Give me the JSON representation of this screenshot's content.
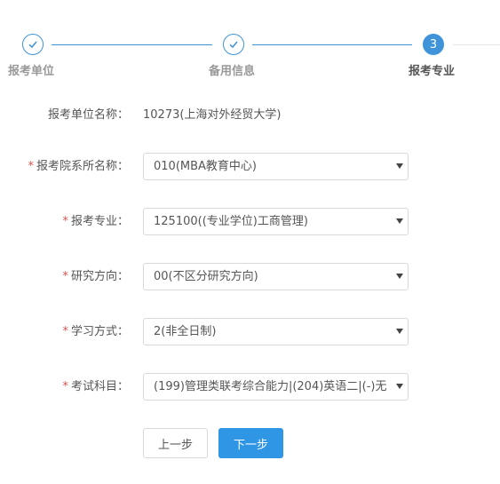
{
  "steps": [
    {
      "label": "报考单位",
      "state": "done"
    },
    {
      "label": "备用信息",
      "state": "done"
    },
    {
      "label": "报考专业",
      "number": "3",
      "state": "active"
    }
  ],
  "form": {
    "unit_label": "报考单位名称：",
    "unit_value": "10273(上海对外经贸大学)",
    "required_mark": "*",
    "department_label": "报考院系所名称：",
    "department_value": "010(MBA教育中心)",
    "major_label": "报考专业：",
    "major_value": "125100((专业学位)工商管理)",
    "direction_label": "研究方向：",
    "direction_value": "00(不区分研究方向)",
    "study_mode_label": "学习方式：",
    "study_mode_value": "2(非全日制)",
    "subjects_label": "考试科目：",
    "subjects_value": "(199)管理类联考综合能力|(204)英语二|(-)无"
  },
  "buttons": {
    "prev": "上一步",
    "next": "下一步"
  },
  "colors": {
    "accent": "#3f93d8",
    "required": "#d9534f",
    "next_button": "#2f96e6"
  },
  "icons": {
    "done": "check-icon",
    "dropdown": "caret-down-icon"
  }
}
